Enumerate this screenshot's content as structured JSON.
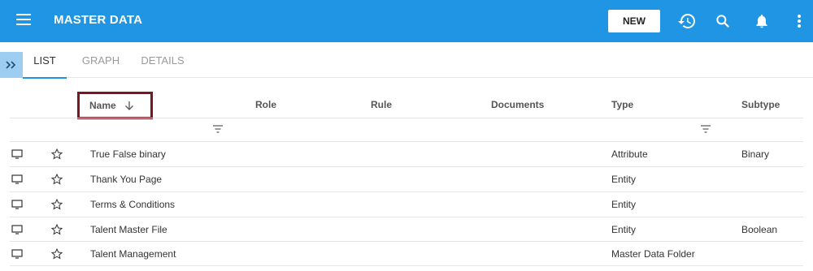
{
  "app": {
    "title": "MASTER DATA",
    "new_label": "NEW"
  },
  "icons": {
    "menu": "menu-icon",
    "history": "history-icon",
    "search": "search-icon",
    "notifications": "bell-icon",
    "more": "more-vert-icon",
    "expand": "double-chevron-right-icon"
  },
  "colors": {
    "appbar": "#1f95e3",
    "tab_indicator": "#1f95e3",
    "highlight_border": "#7a1620"
  },
  "tabs": [
    {
      "label": "LIST",
      "active": true
    },
    {
      "label": "GRAPH",
      "active": false
    },
    {
      "label": "DETAILS",
      "active": false
    }
  ],
  "columns": {
    "name": "Name",
    "role": "Role",
    "rule": "Rule",
    "documents": "Documents",
    "type": "Type",
    "subtype": "Subtype"
  },
  "rows": [
    {
      "name": "True False binary",
      "type": "Attribute",
      "subtype": "Binary"
    },
    {
      "name": "Thank You Page",
      "type": "Entity",
      "subtype": ""
    },
    {
      "name": "Terms & Conditions",
      "type": "Entity",
      "subtype": ""
    },
    {
      "name": "Talent Master File",
      "type": "Entity",
      "subtype": "Boolean"
    },
    {
      "name": "Talent Management",
      "type": "Master Data Folder",
      "subtype": ""
    }
  ]
}
